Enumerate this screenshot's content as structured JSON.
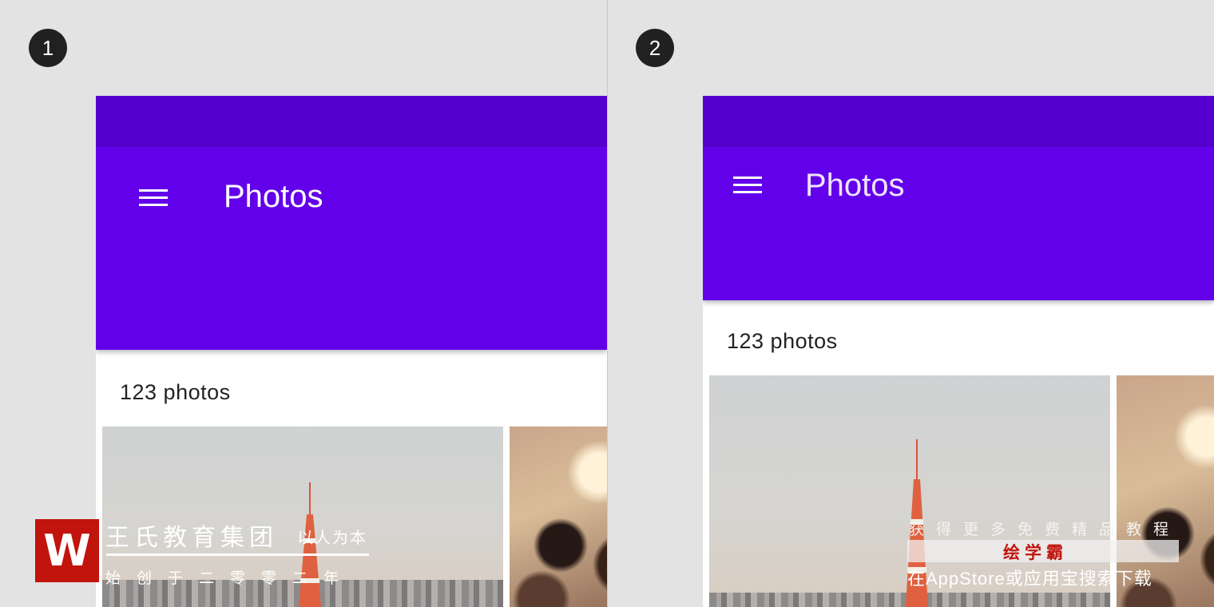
{
  "colors": {
    "background": "#e3e3e3",
    "status_bar": "#5600cf",
    "app_bar": "#6200ea",
    "badge": "#212121",
    "surface": "#ffffff",
    "watermark_red": "#c0140c"
  },
  "panels": [
    {
      "step": "1",
      "app_bar": {
        "menu_icon": "menu-icon",
        "title": "Photos",
        "expanded": true
      },
      "photo_count": "123 photos",
      "photos": [
        "tower-photo",
        "crowd-photo"
      ]
    },
    {
      "step": "2",
      "app_bar": {
        "menu_icon": "menu-icon",
        "title": "Photos",
        "expanded": false
      },
      "photo_count": "123 photos",
      "photos": [
        "tower-photo",
        "crowd-photo"
      ]
    }
  ],
  "watermark_left": {
    "logo": "W",
    "title": "王氏教育集团",
    "slogan": "以人为本",
    "since": "始创于二零零二年"
  },
  "watermark_right": {
    "line1": "获得更多免费精品教程",
    "brand": "绘学霸",
    "line3": "在AppStore或应用宝搜索下载"
  }
}
